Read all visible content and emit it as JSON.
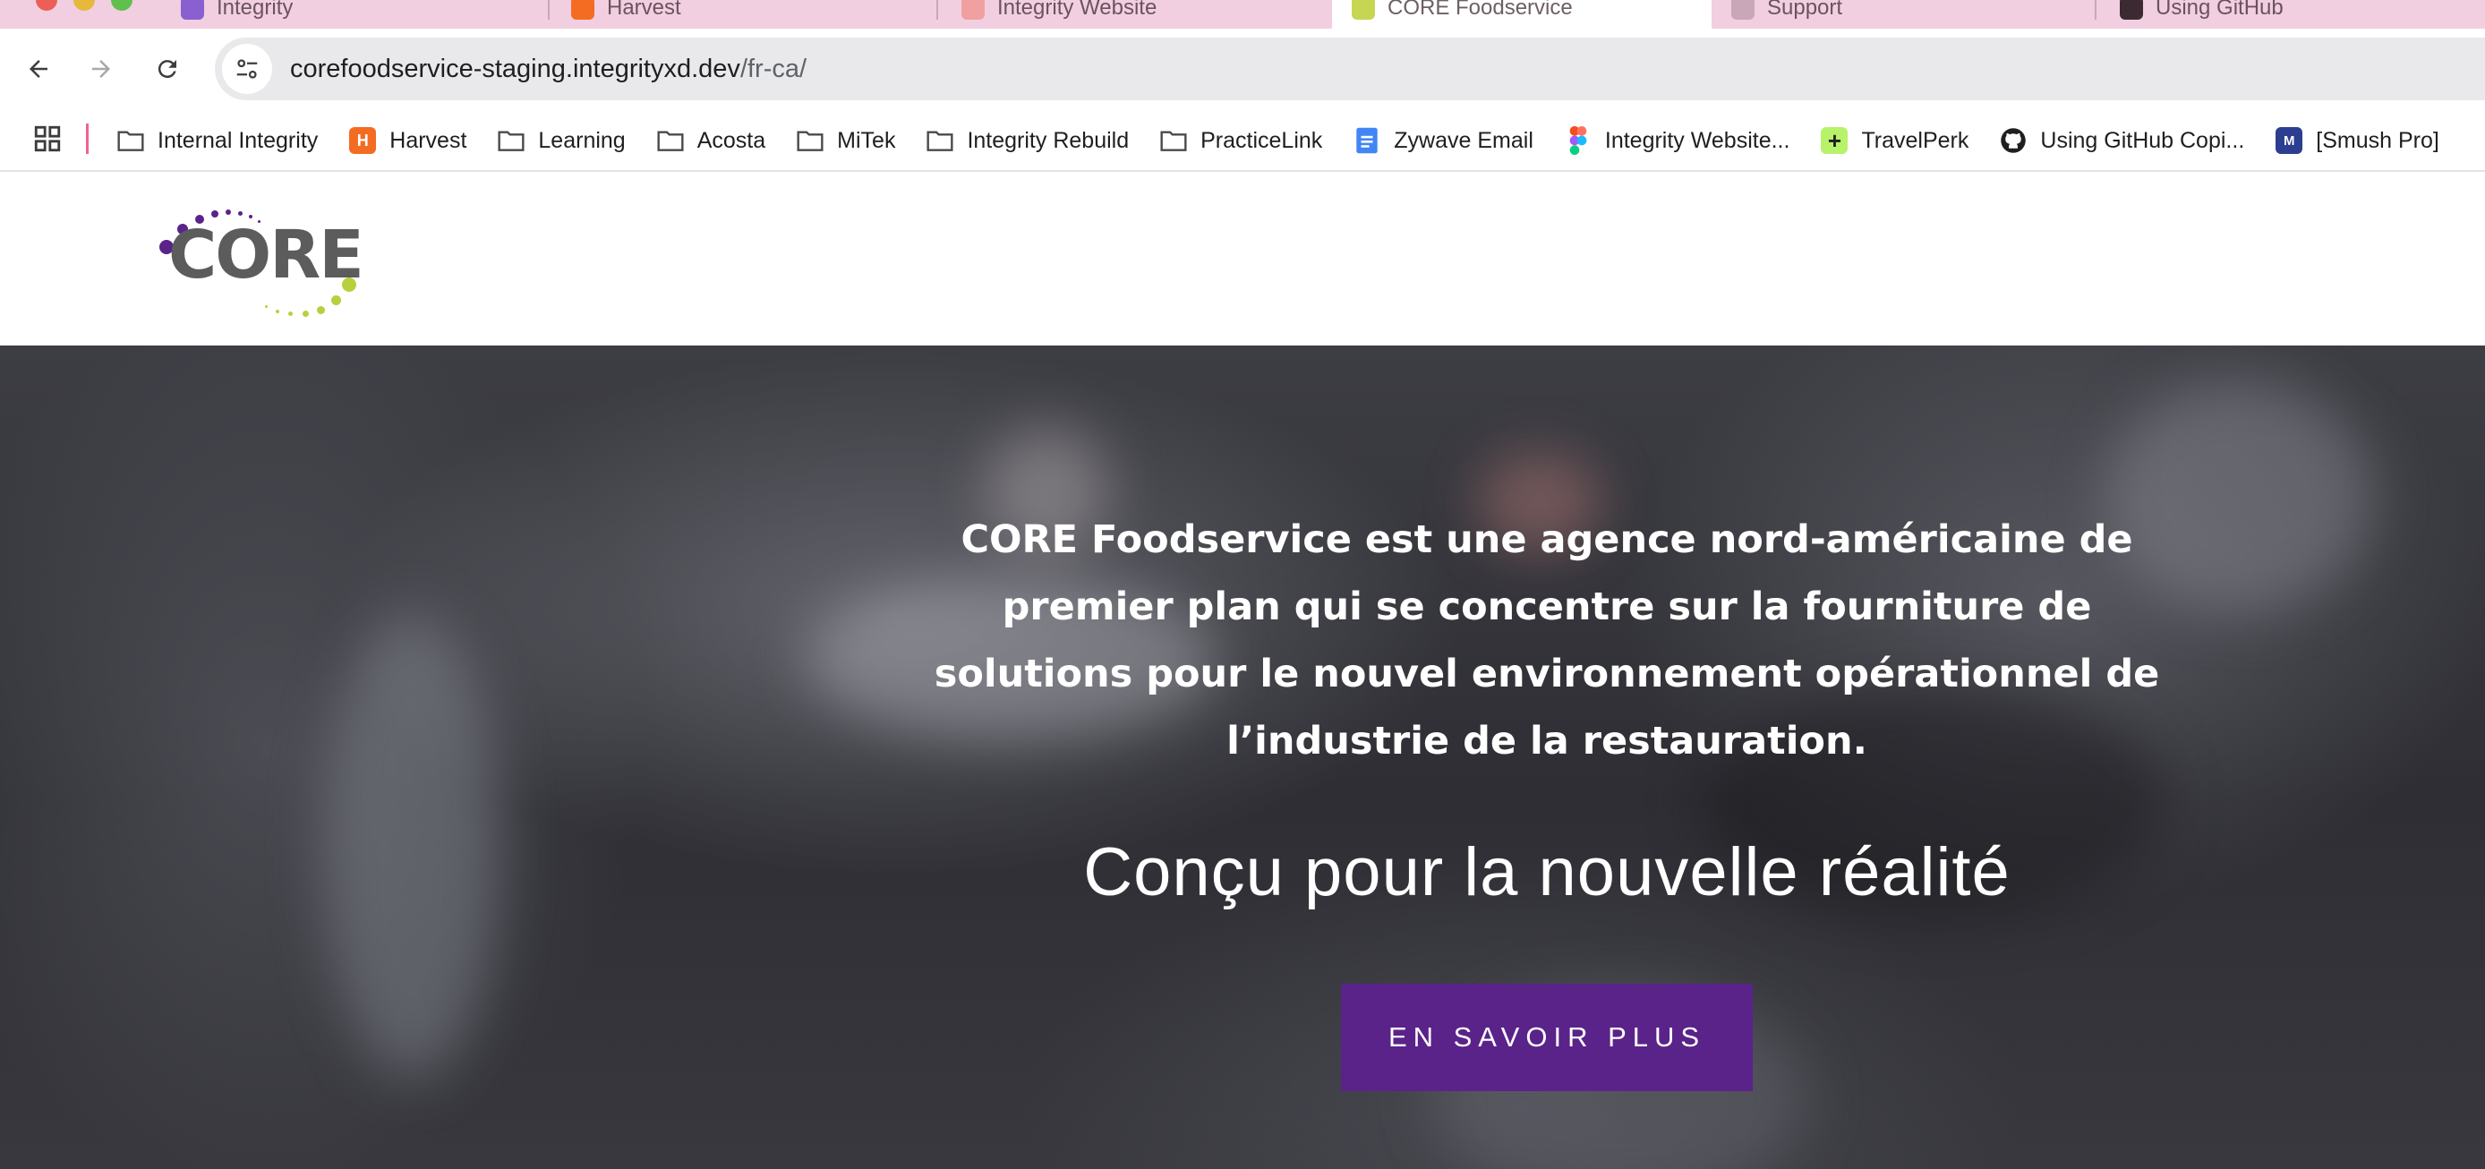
{
  "browser": {
    "tabs": [
      {
        "title": "Integrity",
        "favicon_color": "#8a5fd0",
        "active": false
      },
      {
        "title": "Harvest",
        "favicon_color": "#f36c21",
        "active": false
      },
      {
        "title": "Integrity Website",
        "favicon_color": "#f0a0a0",
        "active": false
      },
      {
        "title": "CORE Foodservice",
        "favicon_color": "#c7d652",
        "active": true
      },
      {
        "title": "Support",
        "favicon_color": "#c9a6b8",
        "active": false
      },
      {
        "title": "Using GitHub",
        "favicon_color": "#3c2a33",
        "active": false
      }
    ],
    "url": {
      "host": "corefoodservice-staging.integrityxd.dev",
      "path": "/fr-ca/"
    },
    "bookmarks": [
      {
        "label": "Internal Integrity",
        "icon": "folder-icon"
      },
      {
        "label": "Harvest",
        "icon": "harvest-icon",
        "color": "#f36c21"
      },
      {
        "label": "Learning",
        "icon": "folder-icon"
      },
      {
        "label": "Acosta",
        "icon": "folder-icon"
      },
      {
        "label": "MiTek",
        "icon": "folder-icon"
      },
      {
        "label": "Integrity Rebuild",
        "icon": "folder-icon"
      },
      {
        "label": "PracticeLink",
        "icon": "folder-icon"
      },
      {
        "label": "Zywave Email",
        "icon": "docs-icon",
        "color": "#4285f4"
      },
      {
        "label": "Integrity Website...",
        "icon": "figma-icon"
      },
      {
        "label": "TravelPerk",
        "icon": "travelperk-icon",
        "color": "#b7f26b"
      },
      {
        "label": "Using GitHub Copi...",
        "icon": "github-icon"
      },
      {
        "label": "[Smush Pro]",
        "icon": "smush-icon",
        "color": "#2c3e8f"
      }
    ]
  },
  "site": {
    "logo_text": "CORE",
    "brand_colors": {
      "purple": "#5a2389",
      "green": "#b9cf3d",
      "grey": "#5c5c5c"
    },
    "hero": {
      "intro": "CORE Foodservice est une agence nord-américaine de premier plan qui se concentre sur la fourniture de solutions pour le nouvel environnement opérationnel de l’industrie de la restauration.",
      "tagline": "Conçu pour la nouvelle réalité",
      "cta_label": "EN SAVOIR PLUS"
    }
  }
}
